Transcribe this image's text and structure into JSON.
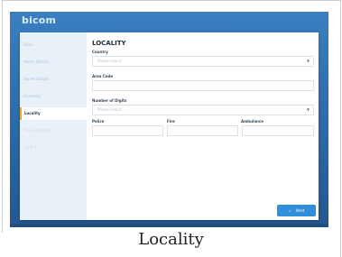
{
  "app": {
    "logo": "bicom"
  },
  "sidebar": {
    "items": [
      {
        "label": "EULA"
      },
      {
        "label": "Admin Details"
      },
      {
        "label": "Server Details"
      },
      {
        "label": "Licensing"
      },
      {
        "label": "Locality"
      },
      {
        "label": "Phone Defaults"
      },
      {
        "label": "Confirm"
      }
    ],
    "active_index": 4
  },
  "form": {
    "title": "LOCALITY",
    "country": {
      "label": "Country",
      "placeholder": "Please select..."
    },
    "area_code": {
      "label": "Area Code",
      "value": ""
    },
    "digits": {
      "label": "Number of Digits",
      "placeholder": "Please select..."
    },
    "police": {
      "label": "Police",
      "value": ""
    },
    "fire": {
      "label": "Fire",
      "value": ""
    },
    "ambulance": {
      "label": "Ambulance",
      "value": ""
    }
  },
  "actions": {
    "next_label": "Next"
  },
  "caption": "Locality",
  "colors": {
    "background_blue": "#2e6fae",
    "accent_orange": "#f2a81d",
    "button_blue": "#2f8fdc"
  }
}
